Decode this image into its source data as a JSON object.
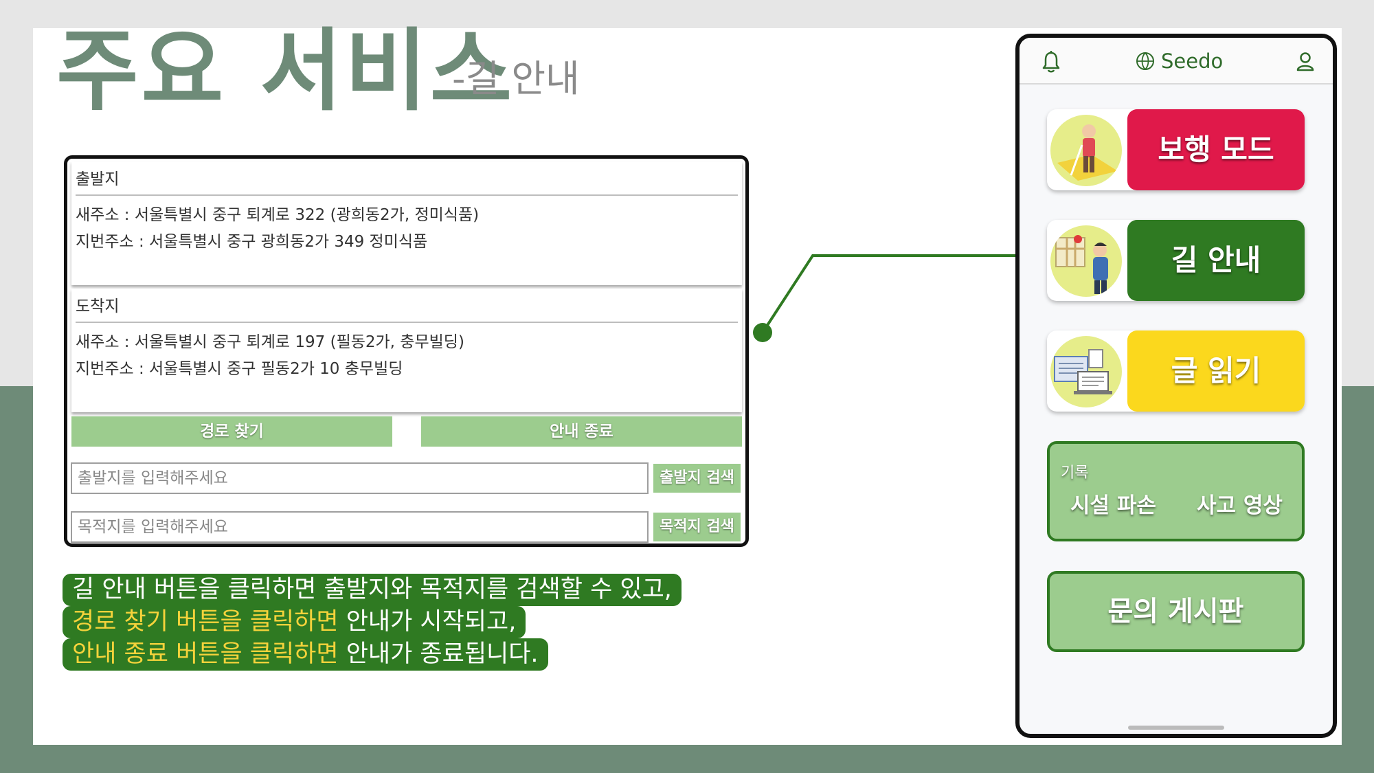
{
  "slide": {
    "title": "주요 서비스",
    "subtitle": "-길 안내"
  },
  "origin": {
    "heading": "출발지",
    "road_address": "새주소 : 서울특별시 중구 퇴계로 322 (광희동2가, 정미식품)",
    "lot_address": "지번주소 : 서울특별시 중구 광희동2가 349 정미식품"
  },
  "destination": {
    "heading": "도착지",
    "road_address": "새주소 : 서울특별시 중구 퇴계로 197 (필동2가, 충무빌딩)",
    "lot_address": "지번주소 : 서울특별시 중구 필동2가 10 충무빌딩"
  },
  "actions": {
    "find_route": "경로 찾기",
    "end_guide": "안내 종료"
  },
  "search": {
    "origin_placeholder": "출발지를 입력해주세요",
    "origin_value": "",
    "origin_button": "출발지 검색",
    "destination_placeholder": "목적지를 입력해주세요",
    "destination_value": "",
    "destination_button": "목적지 검색"
  },
  "caption": {
    "line1": "길 안내 버튼을 클릭하면 출발지와 목적지를 검색할 수 있고,",
    "line2_highlight": "경로 찾기 버튼을 클릭하면",
    "line2_rest": " 안내가 시작되고,",
    "line3_highlight": "안내 종료 버튼을 클릭하면",
    "line3_rest": " 안내가 종료됩니다."
  },
  "phone": {
    "brand": "Seedo",
    "icons": {
      "left": "bell-icon",
      "logo": "globe-icon",
      "right": "user-icon"
    },
    "menu": [
      {
        "label": "보행 모드",
        "color": "#e0194a",
        "illustration": "walking-cane-illustration"
      },
      {
        "label": "길 안내",
        "color": "#2f7a22",
        "illustration": "map-guide-illustration"
      },
      {
        "label": "글 읽기",
        "color": "#fbd81d",
        "illustration": "document-reading-illustration"
      }
    ],
    "record": {
      "title": "기록",
      "items": [
        "시설 파손",
        "사고 영상"
      ]
    },
    "board": "문의 게시판"
  },
  "colors": {
    "accent_green": "#2f7a22",
    "light_green": "#9ccc8e",
    "title_green": "#6e8b78",
    "highlight_yellow": "#f5d33b"
  }
}
